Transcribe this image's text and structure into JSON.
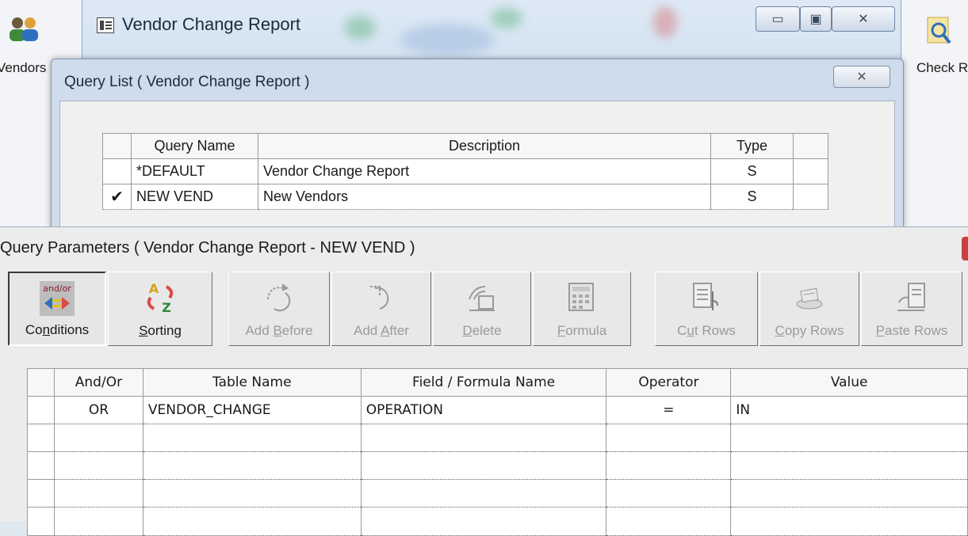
{
  "background": {
    "left_icon_label": "Vendors",
    "right_icon_label": "Check Register"
  },
  "vendor_change_window": {
    "title": "Vendor Change Report",
    "minimize_glyph": "▭",
    "maximize_glyph": "▣",
    "close_glyph": "✕"
  },
  "query_list": {
    "title": "Query List ( Vendor Change Report )",
    "close_glyph": "✕",
    "columns": [
      "Query Name",
      "Description",
      "Type"
    ],
    "rows": [
      {
        "selected": "",
        "name": "*DEFAULT",
        "description": "Vendor Change Report",
        "type": "S"
      },
      {
        "selected": "✔",
        "name": "NEW VEND",
        "description": "New Vendors",
        "type": "S"
      }
    ]
  },
  "query_parameters": {
    "title": "Query Parameters ( Vendor Change Report - NEW VEND )",
    "toolbar": {
      "conditions": {
        "pre": "Co",
        "u": "n",
        "post": "ditions",
        "icon_text": "and/or"
      },
      "sorting": {
        "pre": "",
        "u": "S",
        "post": "orting"
      },
      "add_before": {
        "pre": "Add ",
        "u": "B",
        "post": "efore"
      },
      "add_after": {
        "pre": "Add ",
        "u": "A",
        "post": "fter"
      },
      "delete": {
        "pre": "",
        "u": "D",
        "post": "elete"
      },
      "formula": {
        "pre": "",
        "u": "F",
        "post": "ormula"
      },
      "cut_rows": {
        "pre": "C",
        "u": "u",
        "post": "t Rows"
      },
      "copy_rows": {
        "pre": "",
        "u": "C",
        "post": "opy Rows"
      },
      "paste_rows": {
        "pre": "",
        "u": "P",
        "post": "aste Rows"
      }
    },
    "grid": {
      "columns": [
        "And/Or",
        "Table Name",
        "Field / Formula Name",
        "Operator",
        "Value"
      ],
      "rows": [
        {
          "and_or": "OR",
          "table": "VENDOR_CHANGE",
          "field": "OPERATION",
          "operator": "=",
          "value": "IN"
        },
        {
          "and_or": "",
          "table": "",
          "field": "",
          "operator": "",
          "value": ""
        },
        {
          "and_or": "",
          "table": "",
          "field": "",
          "operator": "",
          "value": ""
        },
        {
          "and_or": "",
          "table": "",
          "field": "",
          "operator": "",
          "value": ""
        },
        {
          "and_or": "",
          "table": "",
          "field": "",
          "operator": "",
          "value": ""
        }
      ]
    }
  }
}
